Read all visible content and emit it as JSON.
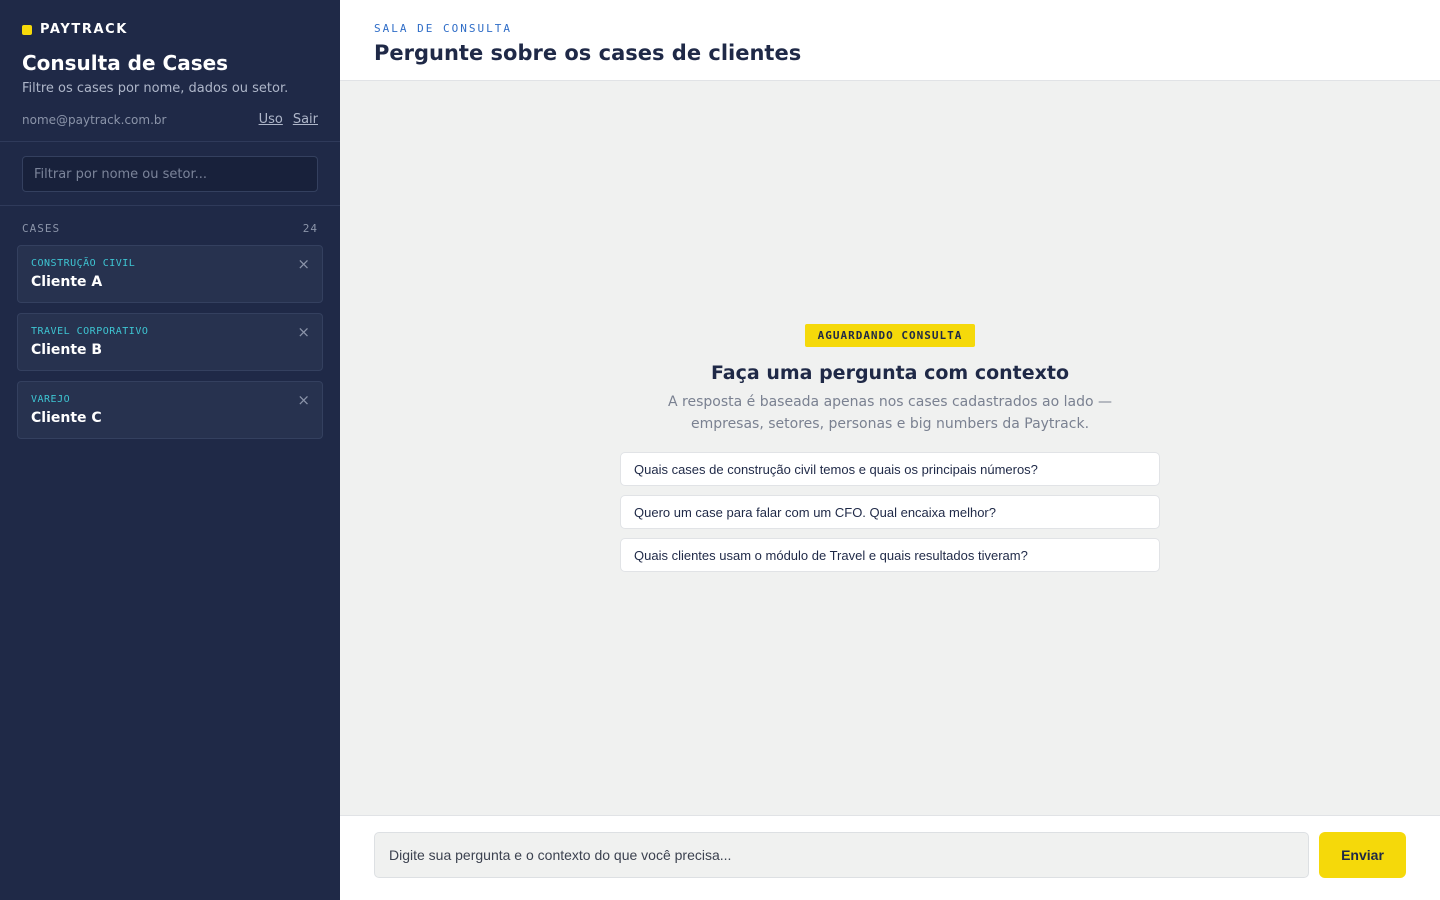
{
  "sidebar": {
    "brand": "PAYTRACK",
    "title": "Consulta de Cases",
    "subtitle": "Filtre os cases por nome, dados ou setor.",
    "user_email": "nome@paytrack.com.br",
    "link_usage": "Uso",
    "link_logout": "Sair",
    "search_placeholder": "Filtrar por nome ou setor...",
    "cases_label": "CASES",
    "cases_count": "24",
    "cases": [
      {
        "sector": "CONSTRUÇÃO CIVIL",
        "name": "Cliente A",
        "close_icon": "×"
      },
      {
        "sector": "TRAVEL CORPORATIVO",
        "name": "Cliente B",
        "close_icon": "×"
      },
      {
        "sector": "VAREJO",
        "name": "Cliente C",
        "close_icon": "×"
      }
    ]
  },
  "header": {
    "kicker": "SALA DE CONSULTA",
    "title": "Pergunte sobre os cases de clientes"
  },
  "empty_state": {
    "badge": "AGUARDANDO CONSULTA",
    "title": "Faça uma pergunta com contexto",
    "subtitle": "A resposta é baseada apenas nos cases cadastrados ao lado — empresas, setores, personas e big numbers da Paytrack.",
    "suggestions": [
      "Quais cases de construção civil temos e quais os principais números?",
      "Quero um case para falar com um CFO. Qual encaixa melhor?",
      "Quais clientes usam o módulo de Travel e quais resultados tiveram?"
    ]
  },
  "composer": {
    "placeholder": "Digite sua pergunta e o contexto do que você precisa...",
    "send_label": "Enviar"
  },
  "colors": {
    "sidebar_bg": "#1f2947",
    "accent_yellow": "#f5d90a",
    "sector_teal": "#3ec6d3",
    "kicker_blue": "#2f6dc7"
  }
}
